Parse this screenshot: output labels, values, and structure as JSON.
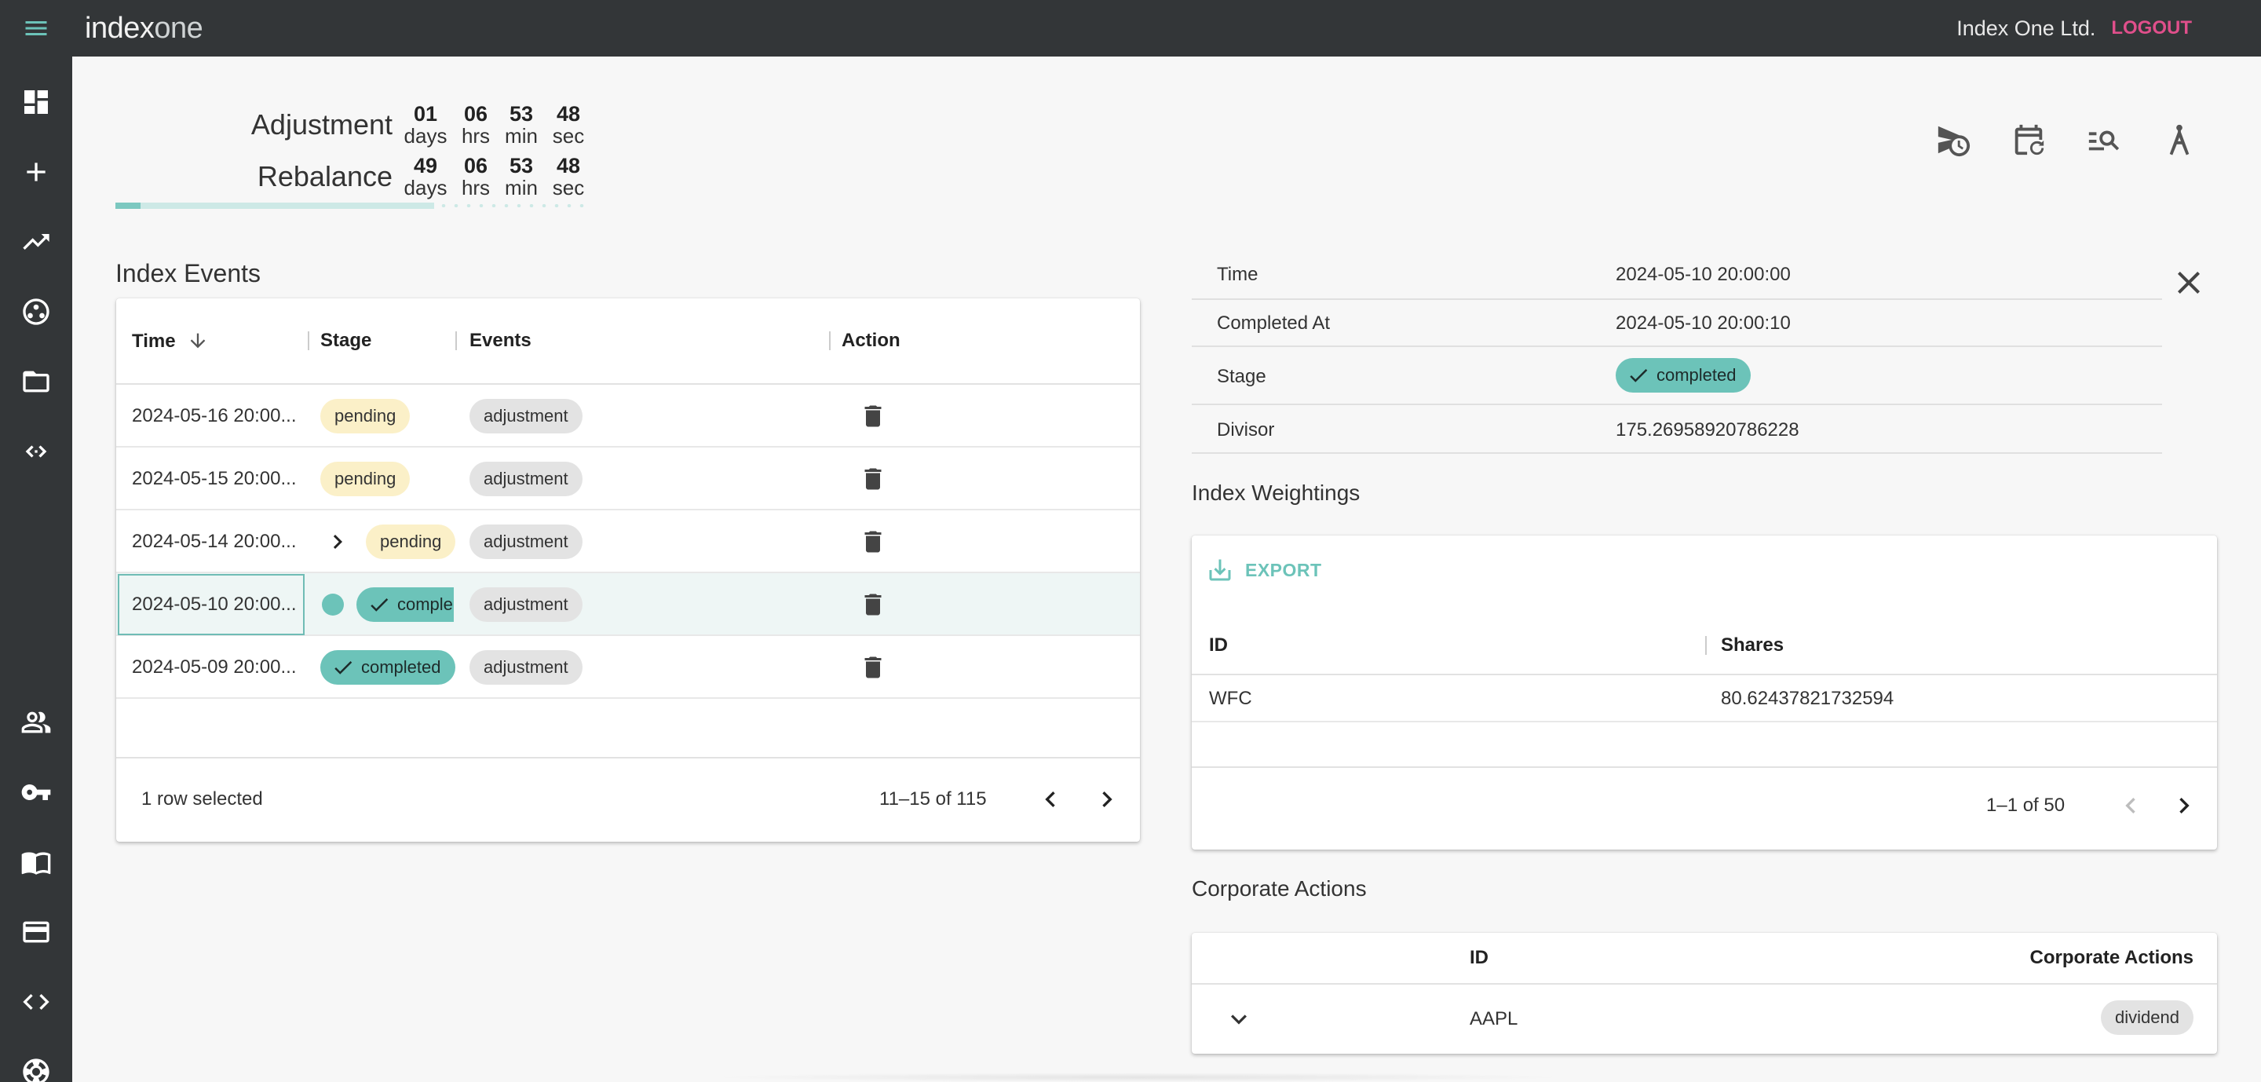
{
  "app": {
    "logo_index": "index",
    "logo_one": "one",
    "org_name": "Index One Ltd.",
    "logout_label": "LOGOUT"
  },
  "sidebar": {
    "items": [
      {
        "icon": "dashboard-icon"
      },
      {
        "icon": "plus-icon"
      },
      {
        "icon": "trending-up-icon"
      },
      {
        "icon": "hub-icon"
      },
      {
        "icon": "folder-icon"
      },
      {
        "icon": "api-icon"
      },
      {
        "icon": "users-icon"
      },
      {
        "icon": "key-icon"
      },
      {
        "icon": "docs-icon"
      },
      {
        "icon": "billing-card-icon"
      },
      {
        "icon": "code-icon"
      },
      {
        "icon": "support-icon"
      }
    ]
  },
  "countdown": {
    "adjustment": {
      "label": "Adjustment",
      "days": "01",
      "hrs": "06",
      "min": "53",
      "sec": "48"
    },
    "rebalance": {
      "label": "Rebalance",
      "days": "49",
      "hrs": "06",
      "min": "53",
      "sec": "48"
    },
    "units": {
      "days": "days",
      "hrs": "hrs",
      "min": "min",
      "sec": "sec"
    },
    "progress_fraction": 0.08
  },
  "toolbar": {
    "icons": [
      "schedule-send-icon",
      "calendar-restore-icon",
      "search-list-icon",
      "compass-icon"
    ]
  },
  "events": {
    "title": "Index Events",
    "columns": {
      "time": "Time",
      "stage": "Stage",
      "events": "Events",
      "action": "Action"
    },
    "rows": [
      {
        "time": "2024-05-16 20:00...",
        "stage": "pending",
        "event": "adjustment"
      },
      {
        "time": "2024-05-15 20:00...",
        "stage": "pending",
        "event": "adjustment"
      },
      {
        "time": "2024-05-14 20:00...",
        "stage": "pending",
        "event": "adjustment"
      },
      {
        "time": "2024-05-10 20:00...",
        "stage": "comple",
        "event": "adjustment"
      },
      {
        "time": "2024-05-09 20:00...",
        "stage": "completed",
        "event": "adjustment"
      }
    ],
    "footer": {
      "selected": "1 row selected",
      "range": "11–15 of 115"
    }
  },
  "detail": {
    "rows": [
      {
        "label": "Time",
        "value": "2024-05-10 20:00:00"
      },
      {
        "label": "Completed At",
        "value": "2024-05-10 20:00:10"
      },
      {
        "label": "Stage",
        "value": "completed"
      },
      {
        "label": "Divisor",
        "value": "175.26958920786228"
      }
    ]
  },
  "weightings": {
    "title": "Index Weightings",
    "export_label": "EXPORT",
    "columns": {
      "id": "ID",
      "shares": "Shares"
    },
    "rows": [
      {
        "id": "WFC",
        "shares": "80.62437821732594"
      }
    ],
    "range": "1–1 of 50"
  },
  "corporate": {
    "title": "Corporate Actions",
    "columns": {
      "id": "ID",
      "actions": "Corporate Actions"
    },
    "rows": [
      {
        "id": "AAPL",
        "action": "dividend"
      }
    ]
  },
  "colors": {
    "accent_teal": "#6cc3b9",
    "logout_pink": "#e04f8b",
    "pending_bg": "#fbf0c8",
    "sidebar_bg": "#333638"
  }
}
